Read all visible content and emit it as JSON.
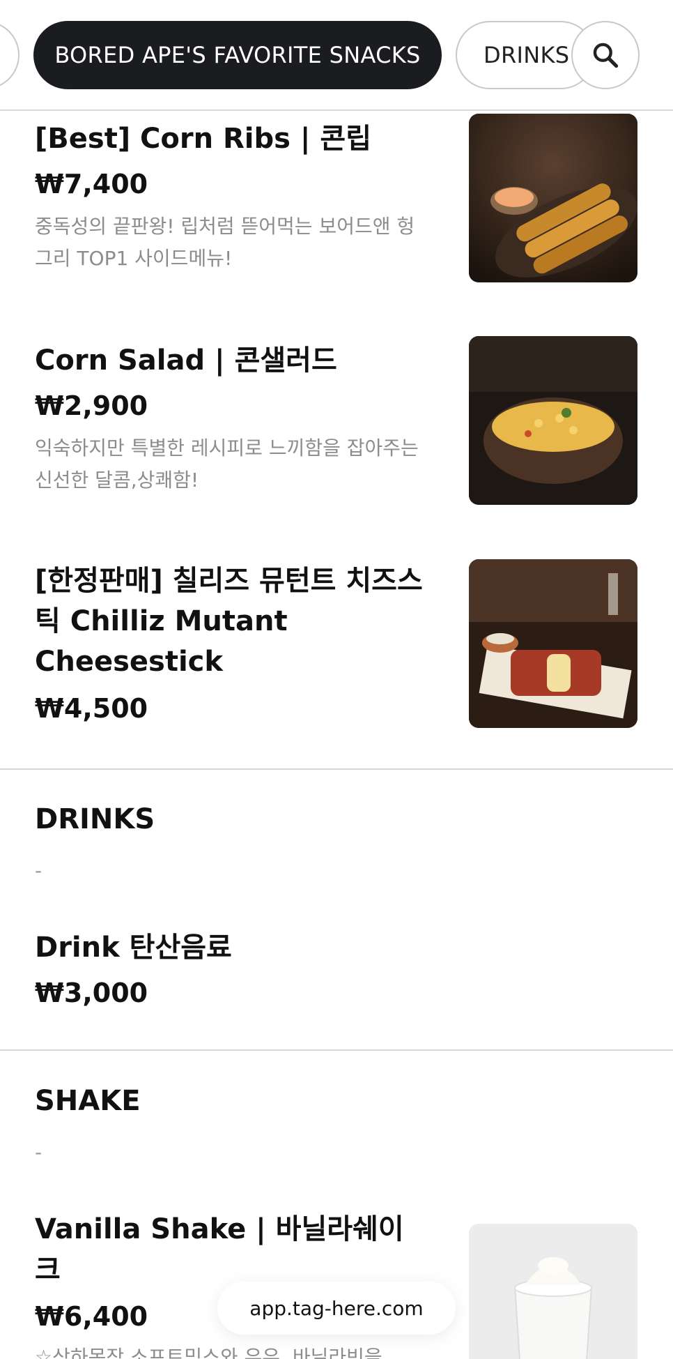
{
  "category_bar": {
    "active_label": "BORED APE'S FAVORITE SNACKS",
    "next_label": "DRINKS",
    "search_icon": "search-icon"
  },
  "items": [
    {
      "name": "[Best] Corn Ribs | 콘립",
      "price": "₩7,400",
      "desc": "중독성의 끝판왕! 립처럼 뜯어먹는 보어드앤 헝그리 TOP1 사이드메뉴!",
      "image": "corn-ribs-photo"
    },
    {
      "name": "Corn Salad | 콘샐러드",
      "price": "₩2,900",
      "desc": "익숙하지만 특별한 레시피로 느끼함을 잡아주는 신선한 달콤,상쾌함!",
      "image": "corn-salad-photo"
    },
    {
      "name": "[한정판매] 칠리즈 뮤턴트 치즈스틱 Chilliz Mutant Cheesestick",
      "price": "₩4,500",
      "image": "cheesestick-photo"
    }
  ],
  "sections": [
    {
      "title": "DRINKS",
      "subtitle": "-",
      "items": [
        {
          "name": "Drink 탄산음료",
          "price": "₩3,000"
        }
      ]
    },
    {
      "title": "SHAKE",
      "subtitle": "-",
      "items": [
        {
          "name": "Vanilla Shake | 바닐라쉐이크",
          "price": "₩6,400",
          "desc": "☆상하목장 소프트믹스와 우유, 바닐라빈을",
          "image": "vanilla-shake-photo"
        }
      ]
    }
  ],
  "footer": {
    "url": "app.tag-here.com"
  }
}
